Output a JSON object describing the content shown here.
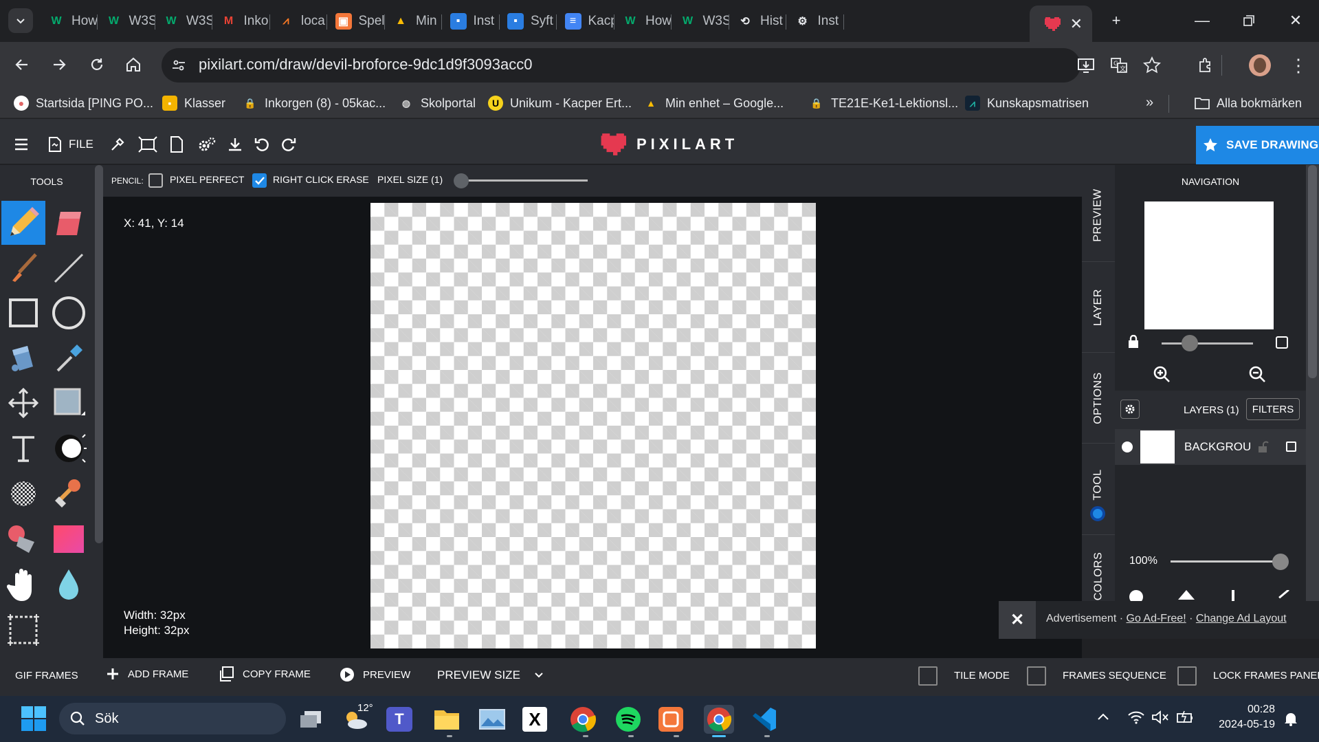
{
  "browser": {
    "tabs": [
      {
        "label": "How",
        "icon": "w3schools-icon"
      },
      {
        "label": "W3S",
        "icon": "w3schools-icon"
      },
      {
        "label": "W3S",
        "icon": "w3schools-icon"
      },
      {
        "label": "Inko",
        "icon": "gmail-icon"
      },
      {
        "label": "loca",
        "icon": "xampp-icon"
      },
      {
        "label": "Spel",
        "icon": "scratch-icon"
      },
      {
        "label": "Min",
        "icon": "drive-icon"
      },
      {
        "label": "Inst",
        "icon": "classroom-icon"
      },
      {
        "label": "Syft",
        "icon": "classroom-icon"
      },
      {
        "label": "Kacp",
        "icon": "docs-icon"
      },
      {
        "label": "How",
        "icon": "w3schools-icon"
      },
      {
        "label": "W3S",
        "icon": "w3schools-icon"
      },
      {
        "label": "Hist",
        "icon": "history-icon"
      },
      {
        "label": "Inst",
        "icon": "settings-icon"
      }
    ],
    "active_tab_icon": "pixilart-heart-icon",
    "url": "pixilart.com/draw/devil-broforce-9dc1d9f3093acc0",
    "bookmarks": [
      {
        "label": "Startsida [PING PO...",
        "icon": "ping-pong-icon"
      },
      {
        "label": "Klasser",
        "icon": "classroom-icon"
      },
      {
        "label": "Inkorgen (8) - 05kac...",
        "icon": "lock-icon"
      },
      {
        "label": "Skolportal",
        "icon": "globe-icon"
      },
      {
        "label": "Unikum - Kacper Ert...",
        "icon": "unikum-icon"
      },
      {
        "label": "Min enhet – Google...",
        "icon": "drive-icon"
      },
      {
        "label": "TE21E-Ke1-Lektionsl...",
        "icon": "lock-icon"
      },
      {
        "label": "Kunskapsmatrisen",
        "icon": "chart-icon"
      }
    ],
    "all_bookmarks": "Alla bokmärken"
  },
  "app": {
    "file_label": "FILE",
    "logo_text": "PIXILART",
    "save_label": "SAVE DRAWING",
    "tools_title": "TOOLS",
    "options": {
      "tool_name": "PENCIL:",
      "pixel_perfect": "PIXEL PERFECT",
      "pixel_perfect_checked": false,
      "right_click_erase": "RIGHT CLICK ERASE",
      "right_click_erase_checked": true,
      "pixel_size": "PIXEL SIZE (1)"
    },
    "coords": "X: 41, Y: 14",
    "width_text": "Width: 32px",
    "height_text": "Height: 32px",
    "side_tabs": [
      "PREVIEW",
      "LAYER",
      "OPTIONS",
      "TOOL",
      "COLORS"
    ],
    "navigation_title": "NAVIGATION",
    "layers_label": "LAYERS (1)",
    "filters_label": "FILTERS",
    "layer_name": "BACKGROUI",
    "opacity": "100%",
    "ad": {
      "label": "Advertisement ·",
      "go_ad_free": "Go Ad-Free!",
      "dot": "·",
      "change_layout": "Change Ad Layout"
    },
    "frames": {
      "gif_frames": "GIF FRAMES",
      "add_frame": "ADD FRAME",
      "copy_frame": "COPY FRAME",
      "preview": "PREVIEW",
      "preview_size": "PREVIEW SIZE",
      "tile_mode": "TILE MODE",
      "frames_sequence": "FRAMES SEQUENCE",
      "lock_frames_panel": "LOCK FRAMES PANEL"
    }
  },
  "taskbar": {
    "search_placeholder": "Sök",
    "weather": "12°",
    "time": "00:28",
    "date": "2024-05-19"
  },
  "colors": {
    "accent": "#1e88e5",
    "pixilart_red": "#e53950"
  }
}
